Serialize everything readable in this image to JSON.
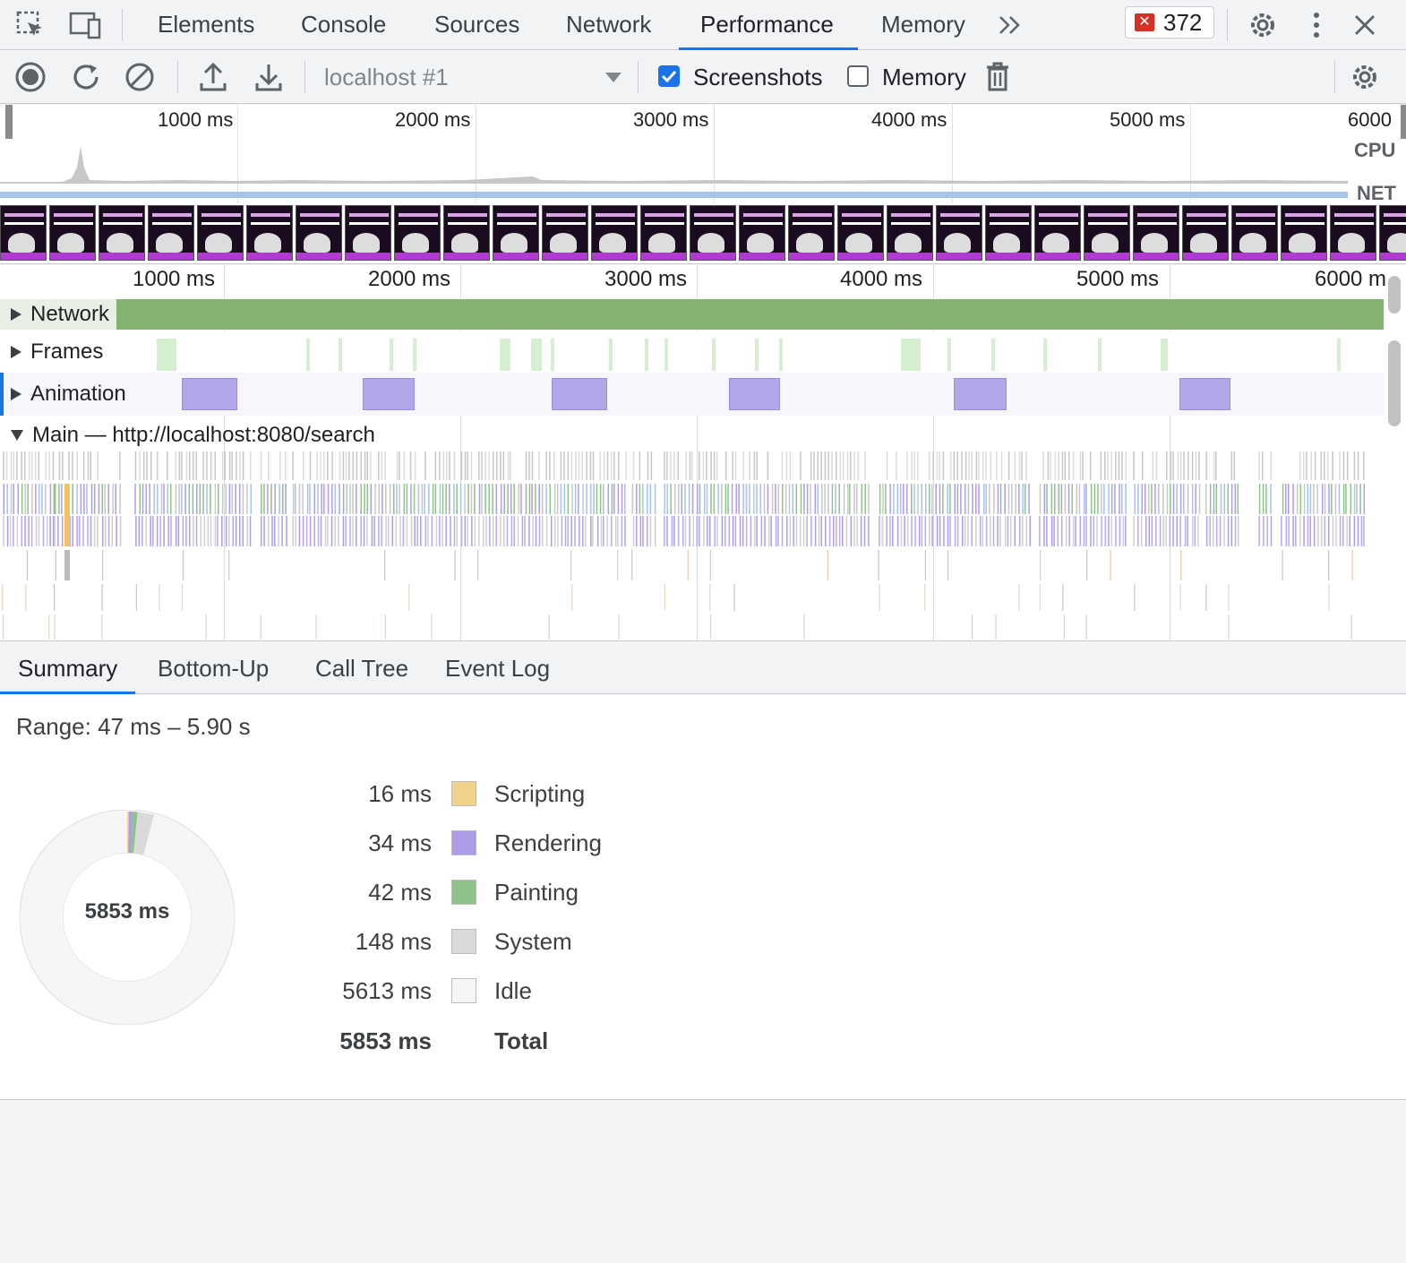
{
  "tabs": {
    "items": [
      "Elements",
      "Console",
      "Sources",
      "Network",
      "Performance",
      "Memory"
    ],
    "active": "Performance",
    "error_count": "372"
  },
  "toolbar": {
    "target": "localhost #1",
    "screenshots_label": "Screenshots",
    "screenshots_checked": true,
    "memory_label": "Memory",
    "memory_checked": false
  },
  "overview": {
    "ticks": [
      "1000 ms",
      "2000 ms",
      "3000 ms",
      "4000 ms",
      "5000 ms",
      "6000"
    ],
    "cpu_label": "CPU",
    "net_label": "NET"
  },
  "timeline": {
    "ticks": [
      "1000 ms",
      "2000 ms",
      "3000 ms",
      "4000 ms",
      "5000 ms",
      "6000 m"
    ],
    "tracks": {
      "network": "Network",
      "frames": "Frames",
      "animation": "Animation",
      "main": "Main — http://localhost:8080/search"
    }
  },
  "bottom_tabs": {
    "items": [
      "Summary",
      "Bottom-Up",
      "Call Tree",
      "Event Log"
    ],
    "active": "Summary"
  },
  "summary": {
    "range": "Range: 47 ms – 5.90 s",
    "total_center": "5853 ms",
    "rows": [
      {
        "value": "16 ms",
        "label": "Scripting",
        "color": "#f2d18b"
      },
      {
        "value": "34 ms",
        "label": "Rendering",
        "color": "#af9ce8"
      },
      {
        "value": "42 ms",
        "label": "Painting",
        "color": "#8ec289"
      },
      {
        "value": "148 ms",
        "label": "System",
        "color": "#dadada"
      },
      {
        "value": "5613 ms",
        "label": "Idle",
        "color": "#f6f6f6"
      }
    ],
    "total": {
      "value": "5853 ms",
      "label": "Total"
    }
  },
  "colors": {
    "accent": "#1a73e8",
    "network_track": "#84b270",
    "animation": "#b3a6e8",
    "frames": "#d6efd0"
  }
}
